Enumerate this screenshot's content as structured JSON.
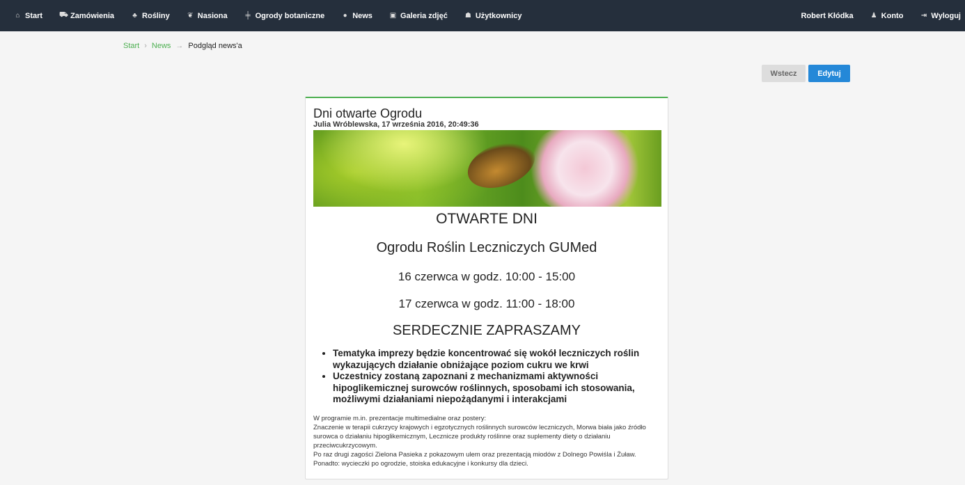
{
  "nav": {
    "items": [
      {
        "icon": "home-icon",
        "glyph": "⌂",
        "label": "Start"
      },
      {
        "icon": "cart-icon",
        "glyph": "⛟",
        "label": "Zamówienia"
      },
      {
        "icon": "tree-icon",
        "glyph": "♣",
        "label": "Rośliny"
      },
      {
        "icon": "leaf-icon",
        "glyph": "❦",
        "label": "Nasiona"
      },
      {
        "icon": "signpost-icon",
        "glyph": "╪",
        "label": "Ogrody botaniczne"
      },
      {
        "icon": "globe-icon",
        "glyph": "●",
        "label": "News"
      },
      {
        "icon": "picture-icon",
        "glyph": "▣",
        "label": "Galeria zdjęć"
      },
      {
        "icon": "users-icon",
        "glyph": "☗",
        "label": "Użytkownicy"
      }
    ],
    "user": "Robert Kłódka",
    "account": {
      "glyph": "♟",
      "label": "Konto"
    },
    "logout": {
      "glyph": "⇥",
      "label": "Wyloguj"
    }
  },
  "breadcrumb": {
    "items": [
      "Start",
      "News"
    ],
    "current": "Podgląd news'a",
    "sep1": "›",
    "sep2": "→"
  },
  "buttons": {
    "back": "Wstecz",
    "edit": "Edytuj"
  },
  "news": {
    "title": "Dni otwarte Ogrodu",
    "meta": "Julia Wróblewska, 17 września 2016, 20:49:36",
    "headings": [
      "OTWARTE DNI",
      "Ogrodu Roślin Leczniczych GUMed",
      "16 czerwca w godz. 10:00 - 15:00",
      "17 czerwca w godz. 11:00 - 18:00",
      "SERDECZNIE ZAPRASZAMY"
    ],
    "bullets": [
      "Tematyka imprezy będzie koncentrować się wokół leczniczych roślin wykazujących działanie obniżające poziom cukru we krwi",
      "Uczestnicy zostaną zapoznani z mechanizmami aktywności hipoglikemicznej surowców roślinnych, sposobami ich stosowania, możliwymi działaniami niepożądanymi i interakcjami"
    ],
    "lines": [
      "W programie m.in. prezentacje multimedialne oraz postery:",
      "Znaczenie w terapii cukrzycy krajowych i egzotycznych roślinnych surowców leczniczych, Morwa biała jako źródło surowca o działaniu hipoglikemicznym, Lecznicze produkty roślinne oraz suplementy diety o działaniu przeciwcukrzycowym.",
      "Po raz drugi zagości Zielona Pasieka z pokazowym ulem oraz prezentacją miodów z Dolnego Powiśla i Żuław.",
      "Ponadto: wycieczki po ogrodzie, stoiska edukacyjne i konkursy dla dzieci."
    ]
  }
}
